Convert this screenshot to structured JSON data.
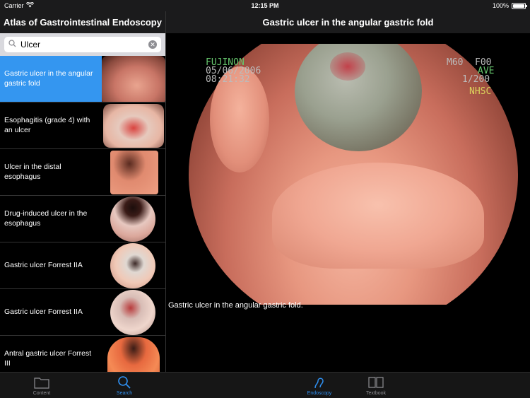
{
  "status": {
    "carrier": "Carrier",
    "time": "12:15 PM",
    "battery": "100%",
    "battery_level": 1.0
  },
  "sidebar": {
    "title": "Atlas of Gastrointestinal Endoscopy",
    "search": {
      "value": "Ulcer",
      "placeholder": "Search"
    },
    "items": [
      {
        "label": "Gastric ulcer in the angular gastric fold",
        "selected": true
      },
      {
        "label": "Esophagitis (grade 4) with an ulcer",
        "selected": false
      },
      {
        "label": "Ulcer in the distal esophagus",
        "selected": false
      },
      {
        "label": "Drug-induced ulcer in the esophagus",
        "selected": false
      },
      {
        "label": "Gastric ulcer Forrest IIA",
        "selected": false
      },
      {
        "label": "Gastric ulcer Forrest IIA",
        "selected": false
      },
      {
        "label": "Antral gastric ulcer Forrest III",
        "selected": false
      }
    ]
  },
  "detail": {
    "title": "Gastric ulcer in the angular gastric fold",
    "caption": "Gastric ulcer in the angular gastric fold.",
    "overlay": {
      "brand": "FUJINON",
      "date": "05/06/2006",
      "time": "08:21:32",
      "mode": "M60",
      "foo": "F00",
      "ave": "AVE",
      "ratio": "1/200",
      "nhsc": "NHSC"
    }
  },
  "tabs": {
    "left": [
      {
        "label": "Content",
        "icon": "folder-icon",
        "active": false
      },
      {
        "label": "Search",
        "icon": "search-icon",
        "active": true
      }
    ],
    "right": [
      {
        "label": "Endoscopy",
        "icon": "endoscope-icon",
        "active": true
      },
      {
        "label": "Textbook",
        "icon": "book-icon",
        "active": false
      }
    ]
  },
  "colors": {
    "accent": "#3496f0",
    "tab_active": "#2f8ff0",
    "tab_inactive": "#8e8e93",
    "bar_bg": "#1b1b1c"
  }
}
